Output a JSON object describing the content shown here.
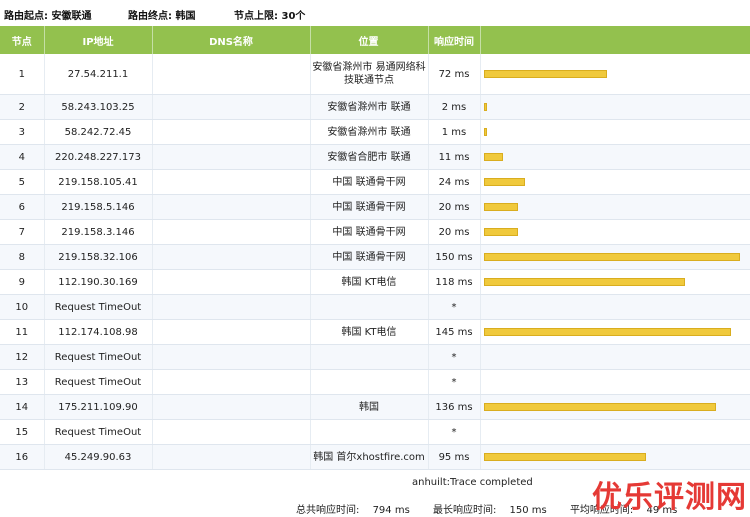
{
  "header": {
    "origin_label": "路由起点:",
    "origin_value": "安徽联通",
    "dest_label": "路由终点:",
    "dest_value": "韩国",
    "limit_label": "节点上限:",
    "limit_value": "30个"
  },
  "columns": [
    "节点",
    "IP地址",
    "DNS名称",
    "位置",
    "响应时间",
    ""
  ],
  "bar_max_ms": 150,
  "bar_color": "#f0c93c",
  "rows": [
    {
      "hop": "1",
      "ip": "27.54.211.1",
      "dns": "",
      "location": "安徽省滁州市 易通网络科技联通节点",
      "time": "72 ms",
      "ms": 72
    },
    {
      "hop": "2",
      "ip": "58.243.103.25",
      "dns": "",
      "location": "安徽省滁州市 联通",
      "time": "2 ms",
      "ms": 2
    },
    {
      "hop": "3",
      "ip": "58.242.72.45",
      "dns": "",
      "location": "安徽省滁州市 联通",
      "time": "1 ms",
      "ms": 1
    },
    {
      "hop": "4",
      "ip": "220.248.227.173",
      "dns": "",
      "location": "安徽省合肥市 联通",
      "time": "11 ms",
      "ms": 11
    },
    {
      "hop": "5",
      "ip": "219.158.105.41",
      "dns": "",
      "location": "中国 联通骨干网",
      "time": "24 ms",
      "ms": 24
    },
    {
      "hop": "6",
      "ip": "219.158.5.146",
      "dns": "",
      "location": "中国 联通骨干网",
      "time": "20 ms",
      "ms": 20
    },
    {
      "hop": "7",
      "ip": "219.158.3.146",
      "dns": "",
      "location": "中国 联通骨干网",
      "time": "20 ms",
      "ms": 20
    },
    {
      "hop": "8",
      "ip": "219.158.32.106",
      "dns": "",
      "location": "中国 联通骨干网",
      "time": "150 ms",
      "ms": 150
    },
    {
      "hop": "9",
      "ip": "112.190.30.169",
      "dns": "",
      "location": "韩国 KT电信",
      "time": "118 ms",
      "ms": 118
    },
    {
      "hop": "10",
      "ip": "Request TimeOut",
      "dns": "",
      "location": "",
      "time": "*",
      "ms": 0
    },
    {
      "hop": "11",
      "ip": "112.174.108.98",
      "dns": "",
      "location": "韩国 KT电信",
      "time": "145 ms",
      "ms": 145
    },
    {
      "hop": "12",
      "ip": "Request TimeOut",
      "dns": "",
      "location": "",
      "time": "*",
      "ms": 0
    },
    {
      "hop": "13",
      "ip": "Request TimeOut",
      "dns": "",
      "location": "",
      "time": "*",
      "ms": 0
    },
    {
      "hop": "14",
      "ip": "175.211.109.90",
      "dns": "",
      "location": "韩国",
      "time": "136 ms",
      "ms": 136
    },
    {
      "hop": "15",
      "ip": "Request TimeOut",
      "dns": "",
      "location": "",
      "time": "*",
      "ms": 0
    },
    {
      "hop": "16",
      "ip": "45.249.90.63",
      "dns": "",
      "location": "韩国 首尔xhostfire.com",
      "time": "95 ms",
      "ms": 95
    }
  ],
  "footer": {
    "status": "anhuilt:Trace completed",
    "total_label": "总共响应时间:",
    "total_value": "794 ms",
    "max_label": "最长响应时间:",
    "max_value": "150 ms",
    "avg_label": "平均响应时间:",
    "avg_value": "49 ms"
  },
  "brand": "优乐评测网"
}
